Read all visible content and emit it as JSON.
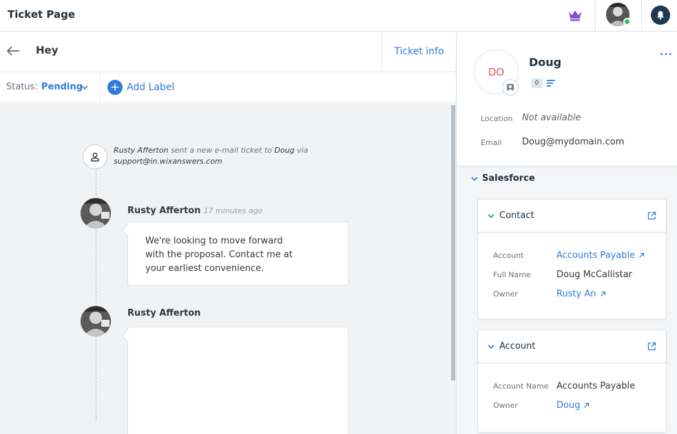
{
  "header": {
    "title": "Ticket Page",
    "icons": [
      "crown-icon",
      "user-avatar",
      "bell-icon"
    ],
    "accent_color": "#2f7cd8",
    "crown_color": "#8a4fd1",
    "online_color": "#2ec26a"
  },
  "ticket": {
    "subject": "Hey",
    "info_button": "Ticket info",
    "status_label": "Status:",
    "status_value": "Pending",
    "add_label": "Add Label"
  },
  "conversation": {
    "event": {
      "actor": "Rusty Afferton",
      "action": "sent a new e-mail ticket to",
      "target": "Doug",
      "via": "via",
      "address": "support@in.wixanswers.com"
    },
    "messages": [
      {
        "author": "Rusty Afferton",
        "time": "17 minutes ago",
        "text": "We're looking to move forward with the proposal. Contact me at your earliest convenience."
      },
      {
        "author": "Rusty Afferton",
        "time": "",
        "text": ""
      }
    ]
  },
  "contact": {
    "initials": "DO",
    "name": "Doug",
    "count": "0",
    "location_label": "Location",
    "location_value": "Not available",
    "email_label": "Email",
    "email_value": "Doug@mydomain.com",
    "more": "..."
  },
  "salesforce": {
    "title": "Salesforce",
    "contact_card": {
      "title": "Contact",
      "fields": [
        {
          "label": "Account",
          "value": "Accounts Payable",
          "link": true
        },
        {
          "label": "Full Name",
          "value": "Doug McCallistar",
          "link": false
        },
        {
          "label": "Owner",
          "value": "Rusty An",
          "link": true
        }
      ]
    },
    "account_card": {
      "title": "Account",
      "fields": [
        {
          "label": "Account Name",
          "value": "Accounts Payable",
          "link": false
        },
        {
          "label": "Owner",
          "value": "Doug",
          "link": true
        }
      ]
    }
  }
}
